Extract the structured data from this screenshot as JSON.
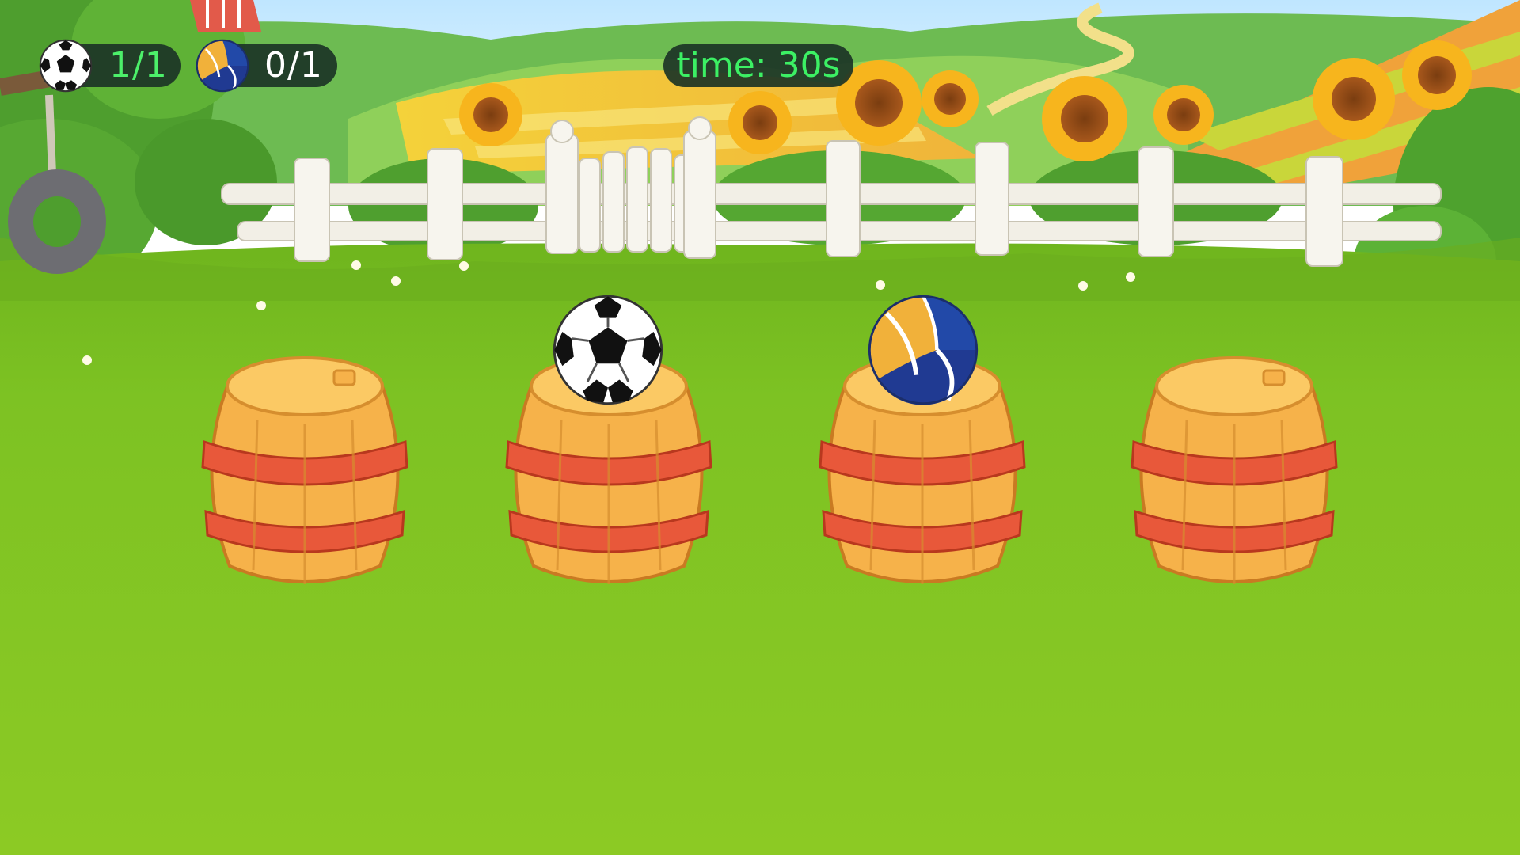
{
  "hud": {
    "soccer": {
      "icon": "soccer-ball-icon",
      "count": "1/1",
      "count_color": "#4cf06a"
    },
    "volleyball": {
      "icon": "volleyball-icon",
      "count": "0/1",
      "count_color": "#ffffff"
    },
    "timer": {
      "text": "time: 30s",
      "color": "#3cf064"
    }
  },
  "barrels": [
    {
      "id": 1,
      "ball": "none"
    },
    {
      "id": 2,
      "ball": "soccer-ball"
    },
    {
      "id": 3,
      "ball": "volleyball"
    },
    {
      "id": 4,
      "ball": "none"
    }
  ],
  "colors": {
    "grass": "#7dc223",
    "barrel_wood": "#f6b24a",
    "barrel_band": "#e8583a",
    "hud_background": "#1c3426"
  }
}
